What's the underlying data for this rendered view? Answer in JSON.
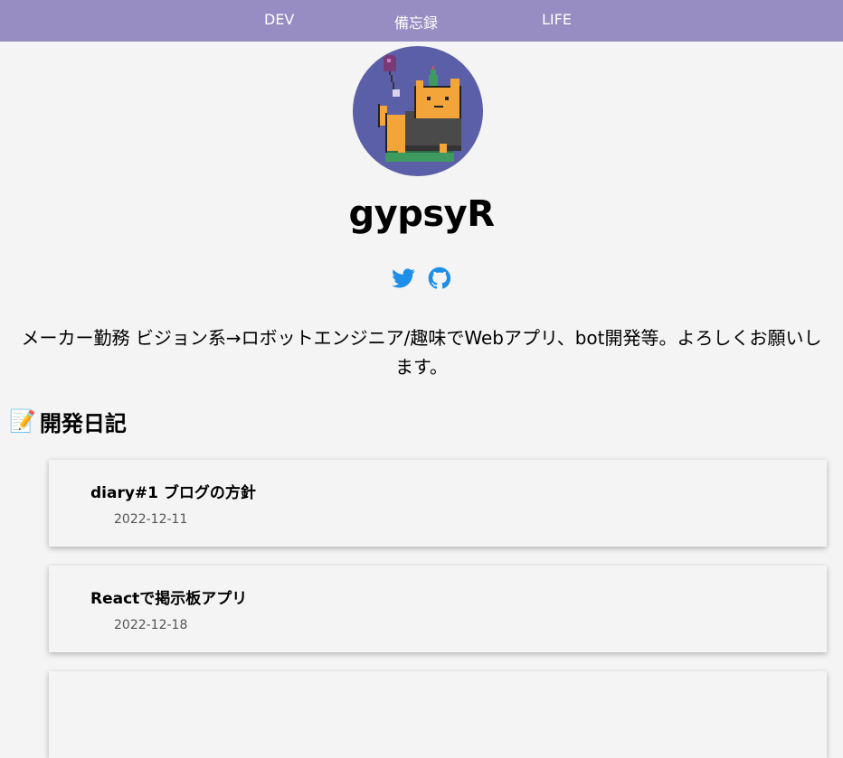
{
  "nav": {
    "items": [
      {
        "label": "DEV"
      },
      {
        "label": "備忘録"
      },
      {
        "label": "LIFE"
      }
    ]
  },
  "profile": {
    "name": "gypsyR",
    "bio": "メーカー勤務 ビジョン系→ロボットエンジニア/趣味でWebアプリ、bot開発等。よろしくお願いします。",
    "social": [
      "twitter-icon",
      "github-icon"
    ],
    "social_color": "#1d8fe8"
  },
  "section": {
    "emoji": "📝",
    "title": "開発日記"
  },
  "posts": [
    {
      "title": "diary#1 ブログの方針",
      "date": "2022-12-11"
    },
    {
      "title": "Reactで掲示板アプリ",
      "date": "2022-12-18"
    },
    {
      "title": "",
      "date": ""
    }
  ],
  "colors": {
    "nav_bg": "#978dc3",
    "page_bg": "#f4f4f4",
    "avatar_bg": "#5b5fa8"
  }
}
